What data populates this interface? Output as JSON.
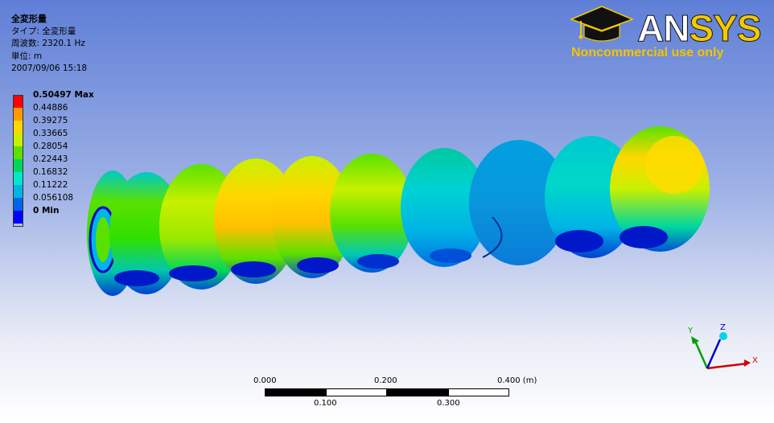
{
  "header": {
    "title": "全変形量",
    "type_line": "タイプ: 全変形量",
    "freq_line": "周波数: 2320.1 Hz",
    "unit_line": "単位: m",
    "date_line": "2007/09/06 15:18"
  },
  "legend": {
    "items": [
      {
        "label": "0.50497 Max",
        "color": "#ff0000",
        "bold": true
      },
      {
        "label": "0.44886",
        "color": "#ff9900"
      },
      {
        "label": "0.39275",
        "color": "#ffd700"
      },
      {
        "label": "0.33665",
        "color": "#c8f000"
      },
      {
        "label": "0.28054",
        "color": "#5ae100"
      },
      {
        "label": "0.22443",
        "color": "#00d75a"
      },
      {
        "label": "0.16832",
        "color": "#00e8c8"
      },
      {
        "label": "0.11222",
        "color": "#00b4e6"
      },
      {
        "label": "0.056108",
        "color": "#0064e6"
      },
      {
        "label": "0 Min",
        "color": "#0000ff",
        "bold": true
      }
    ]
  },
  "logo": {
    "brand_an": "AN",
    "brand_sys": "SYS",
    "notice": "Noncommercial use only"
  },
  "triad": {
    "x": "X",
    "y": "Y",
    "z": "Z"
  },
  "scale_bar": {
    "top_labels": [
      "0.000",
      "0.200",
      "0.400 (m)"
    ],
    "bottom_labels": [
      "0.100",
      "0.300"
    ]
  }
}
